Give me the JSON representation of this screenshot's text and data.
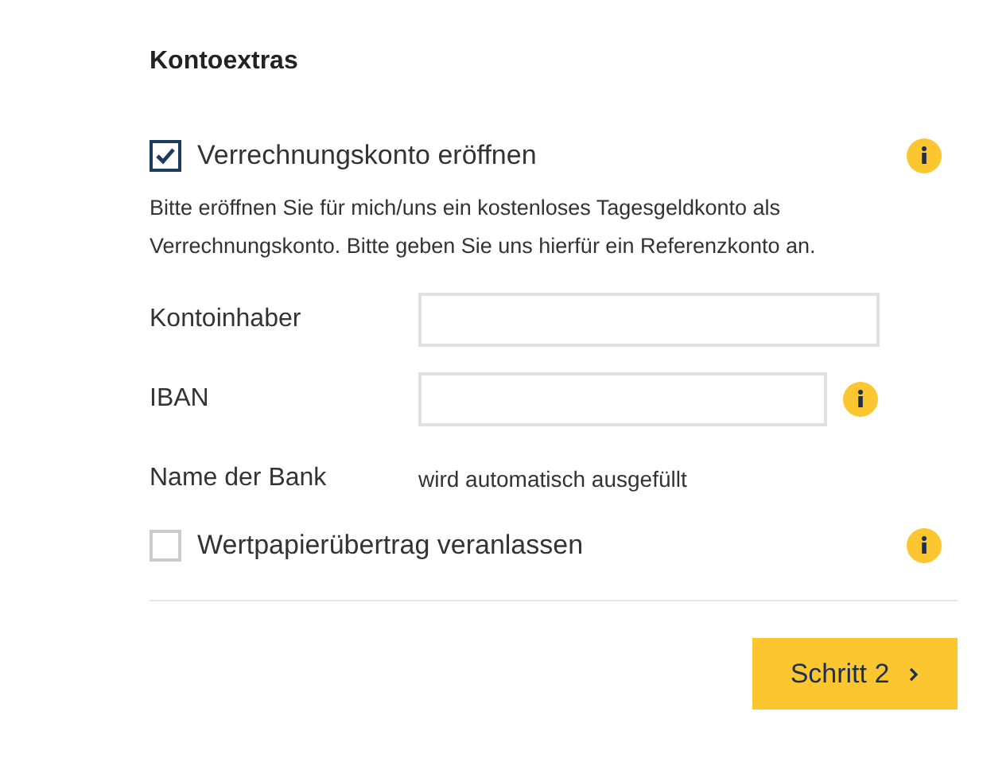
{
  "heading": "Kontoextras",
  "options": [
    {
      "label": "Verrechnungskonto eröffnen",
      "checked": true,
      "info": true
    },
    {
      "label": "Wertpapierübertrag veranlassen",
      "checked": false,
      "info": true
    }
  ],
  "description": "Bitte eröffnen Sie für mich/uns ein kostenloses Tagesgeldkonto als Verrechnungskonto. Bitte geben Sie uns hierfür ein Referenzkonto an.",
  "fields": [
    {
      "kind": "input",
      "label": "Kontoinhaber",
      "info": false
    },
    {
      "kind": "input",
      "label": "IBAN",
      "info": true
    },
    {
      "kind": "static",
      "label": "Name der Bank",
      "value": "wird automatisch ausgefüllt",
      "info": false
    }
  ],
  "next_button": {
    "label": "Schritt 2"
  }
}
